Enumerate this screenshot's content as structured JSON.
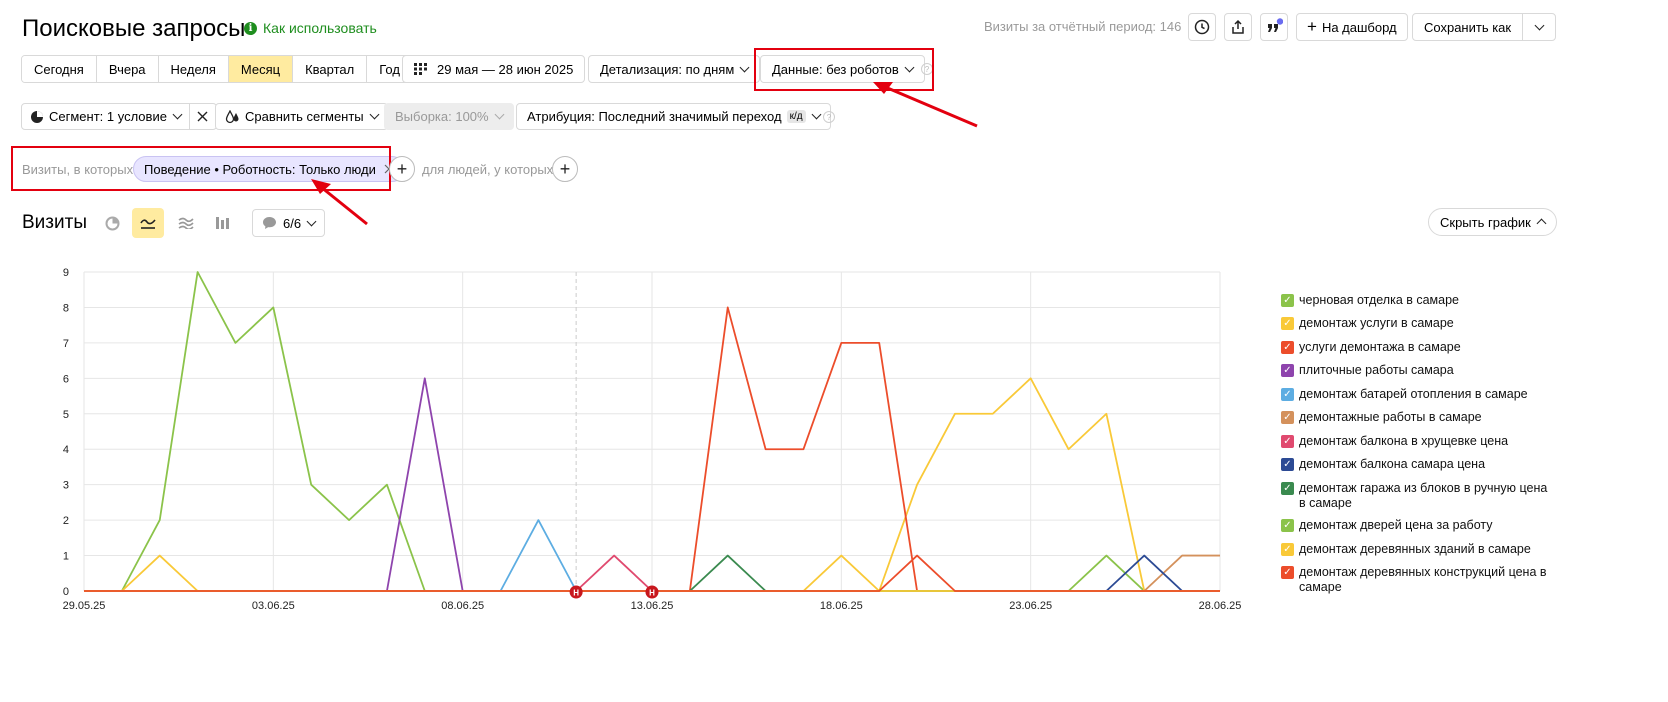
{
  "header": {
    "title": "Поисковые запросы",
    "howto": "Как использовать",
    "info_glyph": "i",
    "visits_period": "Визиты за отчётный период: 146",
    "to_dashboard": "На дашборд",
    "save_as": "Сохранить как"
  },
  "periods": [
    "Сегодня",
    "Вчера",
    "Неделя",
    "Месяц",
    "Квартал",
    "Год"
  ],
  "active_period": "Месяц",
  "date_range": "29 мая — 28 июн 2025",
  "detail": "Детализация: по дням",
  "data_filter": "Данные: без роботов",
  "segment": "Сегмент: 1 условие",
  "compare": "Сравнить сегменты",
  "sample": "Выборка: 100%",
  "attribution": "Атрибуция: Последний значимый переход",
  "attribution_badge": "к/д",
  "filter_row": {
    "prefix": "Визиты, в которых",
    "chip": "Поведение • Роботность: Только люди",
    "people": "для людей, у которых"
  },
  "chart_header": {
    "title": "Визиты",
    "annotations": "6/6",
    "hide_chart": "Скрыть график"
  },
  "chart_data": {
    "type": "line",
    "x": [
      "29.05.25",
      "30.05.25",
      "31.05.25",
      "01.06.25",
      "02.06.25",
      "03.06.25",
      "04.06.25",
      "05.06.25",
      "06.06.25",
      "07.06.25",
      "08.06.25",
      "09.06.25",
      "10.06.25",
      "11.06.25",
      "12.06.25",
      "13.06.25",
      "14.06.25",
      "15.06.25",
      "16.06.25",
      "17.06.25",
      "18.06.25",
      "19.06.25",
      "20.06.25",
      "21.06.25",
      "22.06.25",
      "23.06.25",
      "24.06.25",
      "25.06.25",
      "26.06.25",
      "27.06.25",
      "28.06.25"
    ],
    "x_ticks": [
      "29.05.25",
      "03.06.25",
      "08.06.25",
      "13.06.25",
      "18.06.25",
      "23.06.25",
      "28.06.25"
    ],
    "x_ticks_red": [
      "08.06.25",
      "28.06.25"
    ],
    "y_ticks": [
      "0",
      "1",
      "2",
      "3",
      "4",
      "5",
      "6",
      "7",
      "8",
      "9"
    ],
    "ylim": [
      0,
      9
    ],
    "holiday_markers": [
      "12.06.25",
      "13.06.25"
    ],
    "holiday_label": "H",
    "series": [
      {
        "name": "черновая отделка в самаре",
        "color": "#8bc34a",
        "values": [
          0,
          0,
          2,
          9,
          7,
          8,
          3,
          2,
          3,
          0,
          0,
          0,
          0,
          0,
          0,
          0,
          0,
          0,
          0,
          0,
          0,
          0,
          0,
          0,
          0,
          0,
          0,
          1,
          0,
          0,
          0
        ]
      },
      {
        "name": "демонтаж услуги в самаре",
        "color": "#f9c938",
        "values": [
          0,
          0,
          1,
          0,
          0,
          0,
          0,
          0,
          0,
          0,
          0,
          0,
          0,
          0,
          0,
          0,
          0,
          0,
          0,
          0,
          1,
          0,
          3,
          5,
          5,
          6,
          4,
          5,
          0,
          0,
          0
        ]
      },
      {
        "name": "услуги демонтажа в самаре",
        "color": "#ec4d2b",
        "values": [
          0,
          0,
          0,
          0,
          0,
          0,
          0,
          0,
          0,
          0,
          0,
          0,
          0,
          0,
          0,
          0,
          0,
          8,
          4,
          4,
          7,
          7,
          0,
          0,
          0,
          0,
          0,
          0,
          0,
          0,
          0
        ]
      },
      {
        "name": "плиточные работы самара",
        "color": "#8e44ad",
        "values": [
          0,
          0,
          0,
          0,
          0,
          0,
          0,
          0,
          0,
          6,
          0,
          0,
          0,
          0,
          0,
          0,
          0,
          0,
          0,
          0,
          0,
          0,
          0,
          0,
          0,
          0,
          0,
          0,
          0,
          0,
          0
        ]
      },
      {
        "name": "демонтаж батарей отопления в самаре",
        "color": "#5dade2",
        "values": [
          0,
          0,
          0,
          0,
          0,
          0,
          0,
          0,
          0,
          0,
          0,
          0,
          2,
          0,
          0,
          0,
          0,
          0,
          0,
          0,
          0,
          0,
          0,
          0,
          0,
          0,
          0,
          0,
          0,
          0,
          0
        ]
      },
      {
        "name": "демонтажные работы в самаре",
        "color": "#d4915c",
        "values": [
          0,
          0,
          0,
          0,
          0,
          0,
          0,
          0,
          0,
          0,
          0,
          0,
          0,
          0,
          0,
          0,
          0,
          0,
          0,
          0,
          0,
          0,
          0,
          0,
          0,
          0,
          0,
          0,
          0,
          1,
          1
        ]
      },
      {
        "name": "демонтаж балкона в хрущевке цена",
        "color": "#e04a6f",
        "values": [
          0,
          0,
          0,
          0,
          0,
          0,
          0,
          0,
          0,
          0,
          0,
          0,
          0,
          0,
          1,
          0,
          0,
          0,
          0,
          0,
          0,
          0,
          0,
          0,
          0,
          0,
          0,
          0,
          0,
          0,
          0
        ]
      },
      {
        "name": "демонтаж балкона самара цена",
        "color": "#2c4a94",
        "values": [
          0,
          0,
          0,
          0,
          0,
          0,
          0,
          0,
          0,
          0,
          0,
          0,
          0,
          0,
          0,
          0,
          0,
          0,
          0,
          0,
          0,
          0,
          0,
          0,
          0,
          0,
          0,
          0,
          1,
          0,
          0
        ]
      },
      {
        "name": "демонтаж гаража из блоков в ручную цена в самаре",
        "color": "#3a8a4f",
        "values": [
          0,
          0,
          0,
          0,
          0,
          0,
          0,
          0,
          0,
          0,
          0,
          0,
          0,
          0,
          0,
          0,
          0,
          1,
          0,
          0,
          0,
          0,
          0,
          0,
          0,
          0,
          0,
          0,
          0,
          0,
          0
        ]
      },
      {
        "name": "демонтаж дверей цена за работу",
        "color": "#8bc34a",
        "values": [
          0,
          0,
          0,
          0,
          0,
          0,
          0,
          0,
          0,
          0,
          0,
          0,
          0,
          0,
          0,
          0,
          0,
          0,
          0,
          0,
          0,
          0,
          0,
          0,
          0,
          0,
          0,
          0,
          0,
          0,
          0
        ]
      },
      {
        "name": "демонтаж деревянных зданий в самаре",
        "color": "#f9c938",
        "values": [
          0,
          0,
          0,
          0,
          0,
          0,
          0,
          0,
          0,
          0,
          0,
          0,
          0,
          0,
          0,
          0,
          0,
          0,
          0,
          0,
          0,
          0,
          0,
          0,
          0,
          0,
          0,
          0,
          0,
          0,
          0
        ]
      },
      {
        "name": "демонтаж деревянных конструкций цена в самаре",
        "color": "#ec4d2b",
        "values": [
          0,
          0,
          0,
          0,
          0,
          0,
          0,
          0,
          0,
          0,
          0,
          0,
          0,
          0,
          0,
          0,
          0,
          0,
          0,
          0,
          0,
          0,
          1,
          0,
          0,
          0,
          0,
          0,
          0,
          0,
          0
        ]
      }
    ],
    "grid": true,
    "legend_position": "right"
  }
}
